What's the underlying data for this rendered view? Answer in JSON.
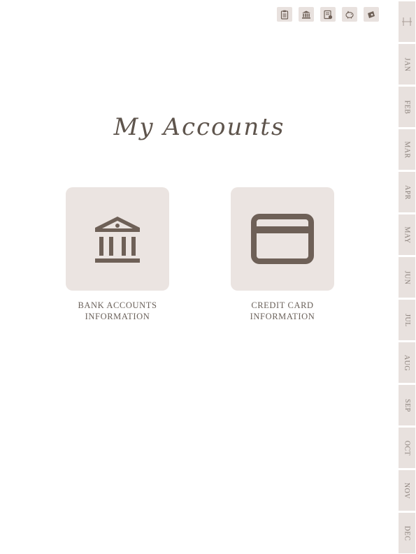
{
  "toolbar": {
    "icons": [
      "clipboard-icon",
      "bank-icon",
      "notes-icon",
      "piggy-bank-icon",
      "wallet-icon"
    ]
  },
  "page": {
    "title": "My Accounts"
  },
  "cards": {
    "bank": {
      "label_line1": "BANK ACCOUNTS",
      "label_line2": "INFORMATION",
      "icon": "bank-building-icon"
    },
    "credit": {
      "label_line1": "CREDIT CARD",
      "label_line2": "INFORMATION",
      "icon": "credit-card-icon"
    }
  },
  "tabs": {
    "menu_icon": "hamburger-icon",
    "months": [
      "JAN",
      "FEB",
      "MAR",
      "APR",
      "MAY",
      "JUN",
      "JUL",
      "AUG",
      "SEP",
      "OCT",
      "NOV",
      "DEC"
    ]
  },
  "colors": {
    "accent": "#6e6057",
    "tile": "#ebe4e1",
    "tab": "#e8e1de",
    "text": "#6b625b"
  }
}
